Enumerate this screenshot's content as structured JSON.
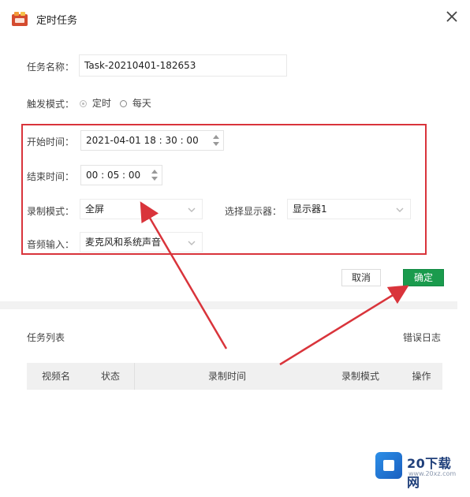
{
  "window": {
    "title": "定时任务"
  },
  "form": {
    "task_name_label": "任务名称：",
    "task_name_value": "Task-20210401-182653",
    "trigger_label": "触发模式：",
    "trigger_options": [
      "定时",
      "每天"
    ],
    "trigger_selected": "定时",
    "start_label": "开始时间：",
    "start_value": "2021-04-01  18 :  30 :  00",
    "end_label": "结束时间：",
    "end_value": "00 :  05 :  00",
    "record_mode_label": "录制模式：",
    "record_mode_value": "全屏",
    "display_label": "选择显示器：",
    "display_value": "显示器1",
    "audio_label": "音频输入：",
    "audio_value": "麦克风和系统声音"
  },
  "buttons": {
    "cancel": "取消",
    "ok": "确定"
  },
  "task_list": {
    "title": "任务列表",
    "error_log": "错误日志",
    "columns": [
      "视频名",
      "状态",
      "录制时间",
      "录制模式",
      "操作"
    ]
  },
  "watermark": {
    "name": "20下载网",
    "url": "www.20xz.com"
  },
  "colors": {
    "highlight_border": "#d9343b",
    "ok_button": "#1a9b4d",
    "arrow": "#d9343b"
  }
}
